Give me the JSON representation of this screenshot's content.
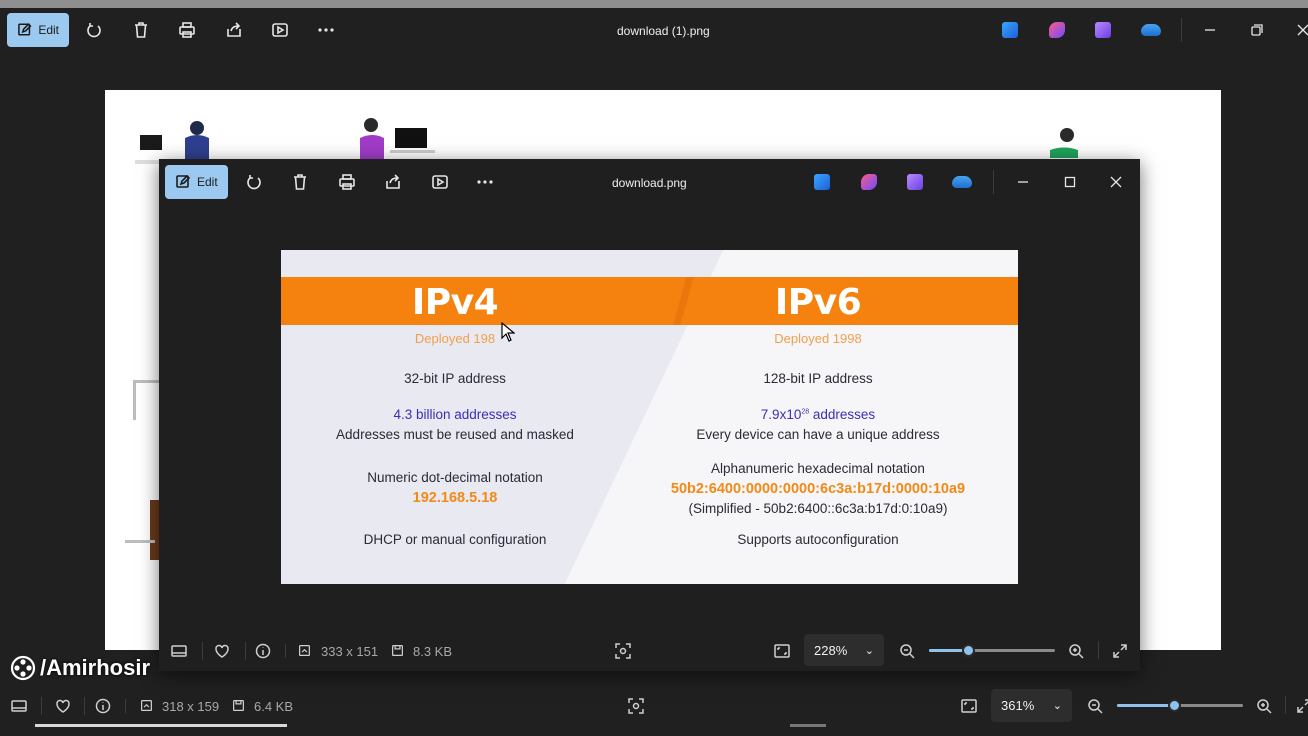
{
  "outer": {
    "edit_label": "Edit",
    "title": "download (1).png",
    "dimensions": "318 x 159",
    "size": "6.4 KB",
    "zoom": "361%",
    "zoom_level": 0.45
  },
  "inner": {
    "edit_label": "Edit",
    "title": "download.png",
    "dimensions": "333 x 151",
    "size": "8.3 KB",
    "zoom": "228%",
    "zoom_level": 0.31
  },
  "slide": {
    "ipv4": {
      "header": "IPv4",
      "deployed": "Deployed 198",
      "bits": "32-bit IP address",
      "addresses": "4.3 billion addresses",
      "reuse": "Addresses must be reused and masked",
      "notation": "Numeric dot-decimal notation",
      "example": "192.168.5.18",
      "config": "DHCP or manual configuration"
    },
    "ipv6": {
      "header": "IPv6",
      "deployed": "Deployed 1998",
      "bits": "128-bit IP address",
      "addresses_base": "7.9x10",
      "addresses_exp": "28",
      "addresses_suffix": " addresses",
      "unique": "Every device can have a unique address",
      "notation": "Alphanumeric hexadecimal notation",
      "example": "50b2:6400:0000:0000:6c3a:b17d:0000:10a9",
      "simplified": "(Simplified - 50b2:6400::6c3a:b17d:0:10a9)",
      "config": "Supports autoconfiguration"
    }
  },
  "watermark": "/Amirhosir",
  "colors": {
    "accent": "#9cc9ef",
    "orange": "#f5820f",
    "blue_text": "#3a2fb5"
  }
}
